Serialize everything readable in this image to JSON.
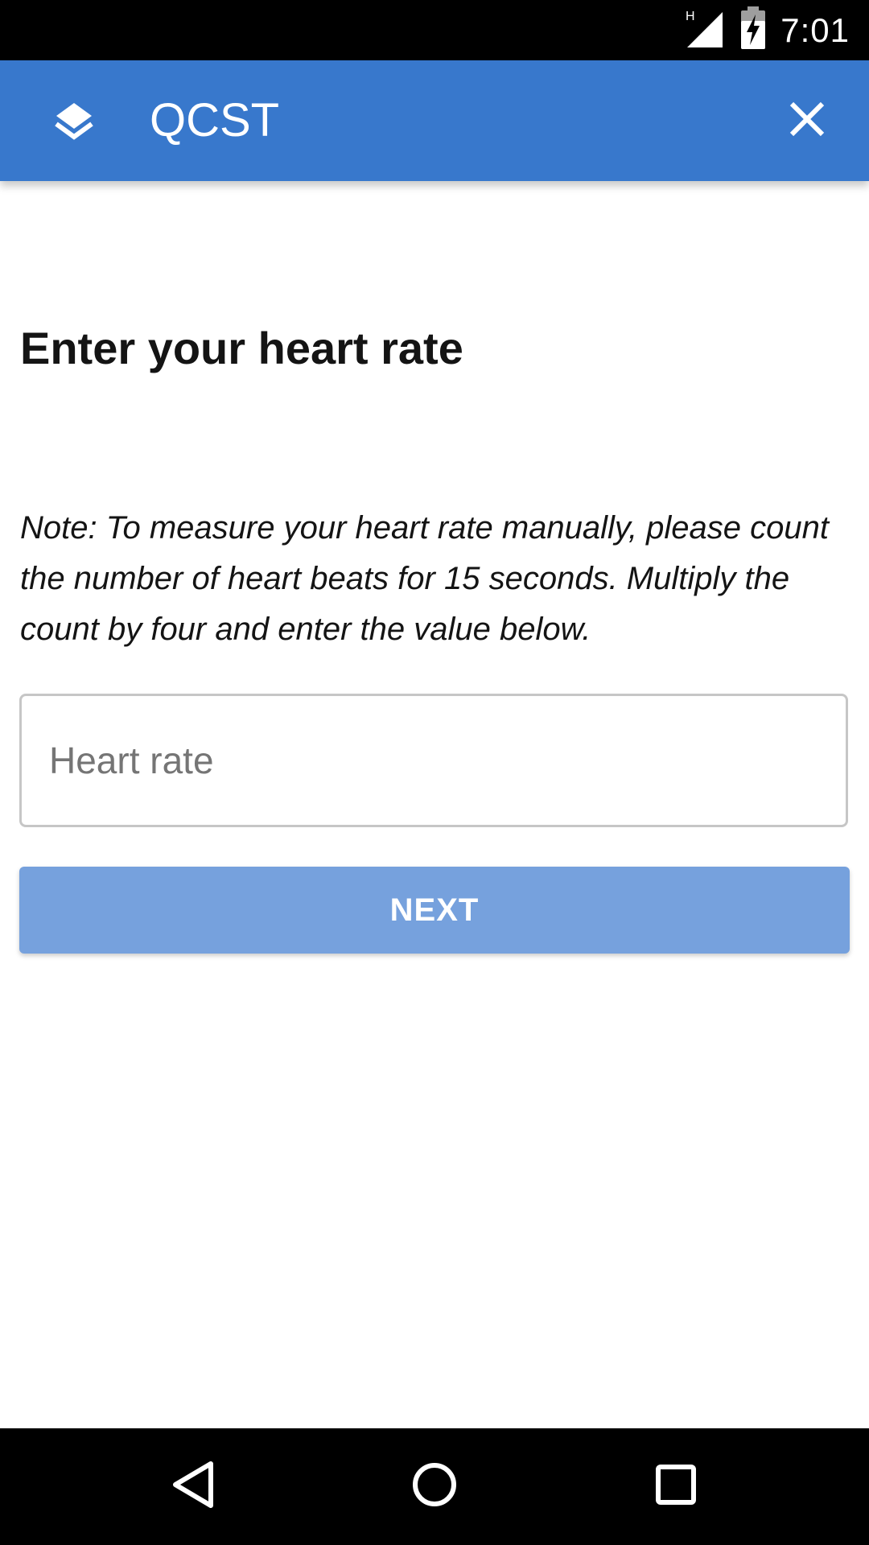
{
  "status_bar": {
    "network_type": "H",
    "time": "7:01"
  },
  "app_bar": {
    "title": "QCST",
    "app_icon": "layers-icon",
    "close_icon": "close-icon",
    "background_color": "#3878cc"
  },
  "form": {
    "heading": "Enter your heart rate",
    "note": "Note: To measure your heart rate manually, please count the number of heart beats for 15 seconds. Multiply the count by four and enter the value below.",
    "heart_rate_input": {
      "value": "",
      "placeholder": "Heart rate"
    },
    "next_button_label": "NEXT",
    "next_button_color": "#76a1dd"
  },
  "nav_bar": {
    "back_icon": "back-triangle-icon",
    "home_icon": "home-circle-icon",
    "recents_icon": "recents-square-icon"
  }
}
